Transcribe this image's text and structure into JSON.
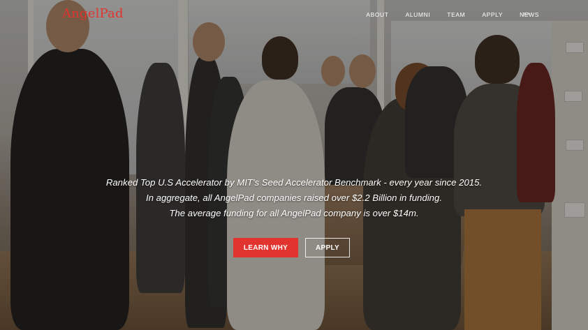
{
  "logo": {
    "text": "AngelPad",
    "color": "#e2342f"
  },
  "nav": {
    "items": [
      "ABOUT",
      "ALUMNI",
      "TEAM",
      "APPLY",
      "NEWS"
    ],
    "more": ">>"
  },
  "hero": {
    "lines": [
      "Ranked Top U.S Accelerator by MIT's Seed Accelerator Benchmark - every year since 2015.",
      "In aggregate, all AngelPad companies raised over $2.2 Billion in funding.",
      "The average funding for all AngelPad company is over $14m."
    ],
    "primary_button": "LEARN WHY",
    "secondary_button": "APPLY",
    "accent": "#e2342f"
  }
}
